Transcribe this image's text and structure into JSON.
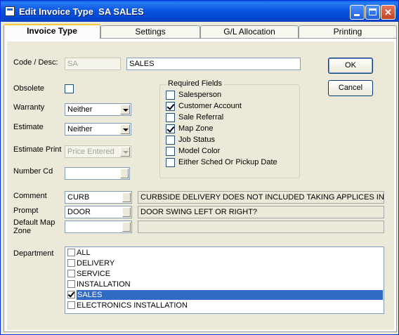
{
  "window": {
    "title": "Edit Invoice Type  SA SALES"
  },
  "tabs": [
    "Invoice Type",
    "Settings",
    "G/L Allocation",
    "Printing"
  ],
  "labels": {
    "code_desc": "Code / Desc:",
    "obsolete": "Obsolete",
    "warranty": "Warranty",
    "estimate": "Estimate",
    "estimate_print": "Estimate Print",
    "number_cd": "Number  Cd",
    "comment": "Comment",
    "prompt": "Prompt",
    "default_map_zone_1": "Default Map",
    "default_map_zone_2": "Zone",
    "department": "Department"
  },
  "fields": {
    "code": "SA",
    "desc": "SALES",
    "obsolete_checked": false,
    "warranty": "Neither",
    "estimate": "Neither",
    "estimate_print": "Price Entered",
    "number_cd": "",
    "comment_code": "CURB",
    "comment_text": "CURBSIDE DELIVERY DOES NOT INCLUDED TAKING APPLICES INT",
    "prompt_code": "DOOR",
    "prompt_text": "DOOR SWING LEFT OR RIGHT?",
    "default_map_zone": "",
    "default_map_zone_desc": ""
  },
  "required_fields": {
    "title": "Required Fields",
    "items": [
      {
        "label": "Salesperson",
        "checked": false
      },
      {
        "label": "Customer Account",
        "checked": true
      },
      {
        "label": "Sale Referral",
        "checked": false
      },
      {
        "label": "Map Zone",
        "checked": true
      },
      {
        "label": "Job Status",
        "checked": false
      },
      {
        "label": "Model Color",
        "checked": false
      },
      {
        "label": "Either Sched Or Pickup Date",
        "checked": false
      }
    ]
  },
  "buttons": {
    "ok": "OK",
    "cancel": "Cancel"
  },
  "departments": [
    {
      "label": "ALL",
      "checked": false,
      "selected": false
    },
    {
      "label": "DELIVERY",
      "checked": false,
      "selected": false
    },
    {
      "label": "SERVICE",
      "checked": false,
      "selected": false
    },
    {
      "label": "INSTALLATION",
      "checked": false,
      "selected": false
    },
    {
      "label": "SALES",
      "checked": true,
      "selected": true
    },
    {
      "label": "ELECTRONICS INSTALLATION",
      "checked": false,
      "selected": false
    }
  ],
  "colors": {
    "titlebar": "#0a55e0",
    "selection": "#316ac5",
    "tab_highlight": "#ffc83c"
  }
}
